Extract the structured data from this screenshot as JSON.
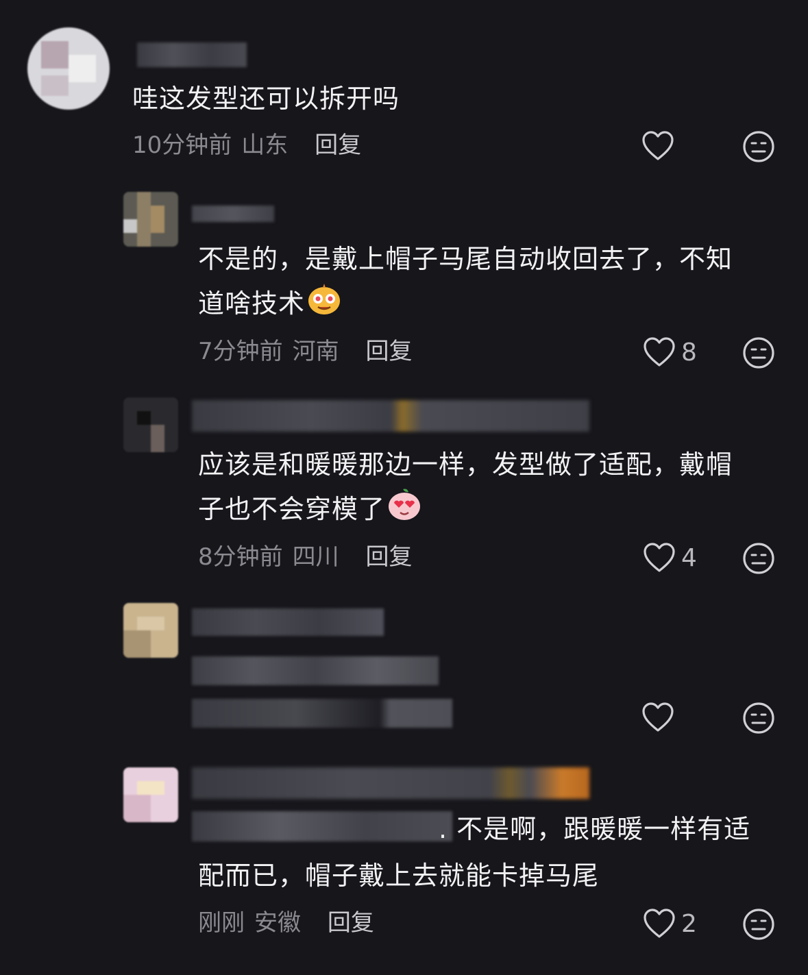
{
  "comments": [
    {
      "text": "哇这发型还可以拆开吗",
      "time": "10分钟前",
      "location": "山东",
      "reply_label": "回复",
      "likes": ""
    },
    {
      "text_line1": "不是的，是戴上帽子马尾自动收回去了，不知",
      "text_line2": "道啥技术",
      "time": "7分钟前",
      "location": "河南",
      "reply_label": "回复",
      "likes": "8"
    },
    {
      "text_line1": "应该是和暖暖那边一样，发型做了适配，戴帽",
      "text_line2": "子也不会穿模了",
      "time": "8分钟前",
      "location": "四川",
      "reply_label": "回复",
      "likes": "4"
    },
    {
      "likes": ""
    },
    {
      "text_line1": ". 不是啊，跟暖暖一样有适",
      "text_line2": "配而已，帽子戴上去就能卡掉马尾",
      "time": "刚刚",
      "location": "安徽",
      "reply_label": "回复",
      "likes": "2"
    }
  ],
  "colors": {
    "background": "#16161b",
    "text": "#f2f2f4",
    "meta": "#8a8a90"
  },
  "icons": [
    "heart-icon",
    "neutral-face-icon",
    "star-eyes-emoji",
    "heart-eyes-emoji"
  ]
}
